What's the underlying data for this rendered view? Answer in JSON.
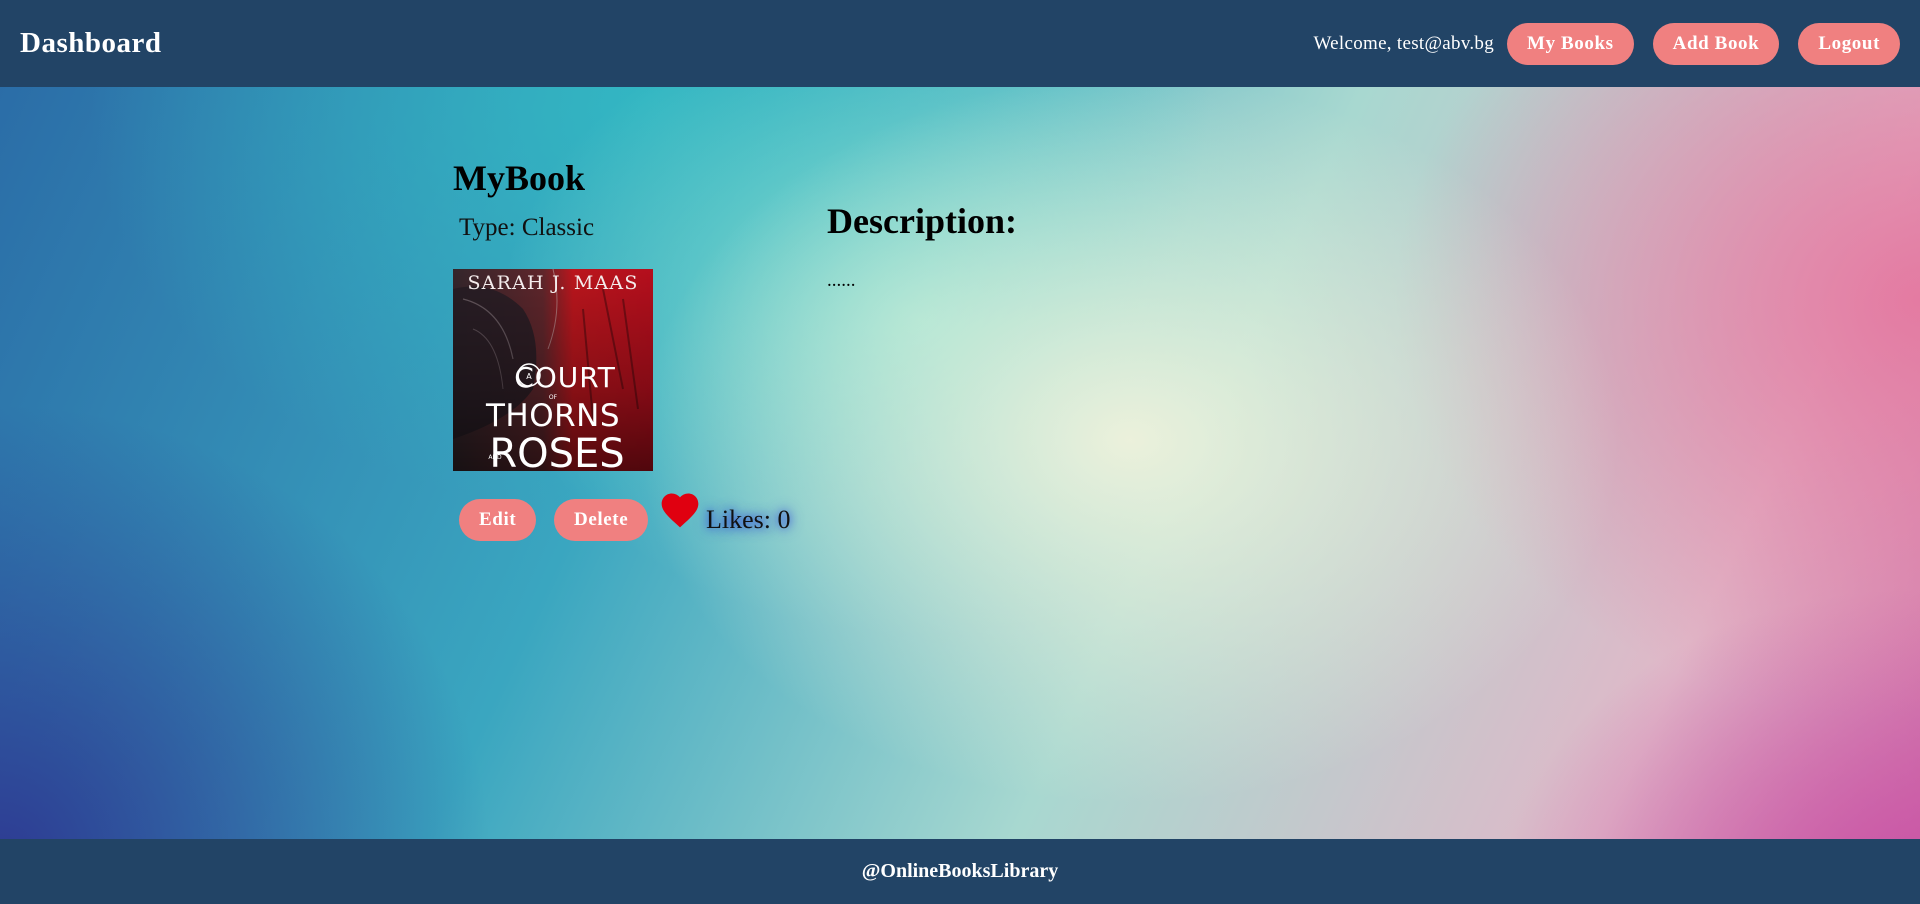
{
  "header": {
    "brand": "Dashboard",
    "welcome": "Welcome, test@abv.bg",
    "nav": {
      "my_books": "My Books",
      "add_book": "Add Book",
      "logout": "Logout"
    }
  },
  "book": {
    "title": "MyBook",
    "type": "Type: Classic",
    "cover": {
      "author": "SARAH J. MAAS",
      "line1": "COURT",
      "line2": "THORNS",
      "line3": "ROSES",
      "small_a": "A",
      "small_of": "OF",
      "small_and": "AND"
    },
    "edit_label": "Edit",
    "delete_label": "Delete",
    "likes": "Likes: 0"
  },
  "description": {
    "heading": "Description:",
    "text": "......"
  },
  "footer": {
    "text": "@OnlineBooksLibrary"
  },
  "colors": {
    "header_bg": "#224466",
    "button_bg": "#f08080",
    "heart": "#e00010"
  },
  "icons": {
    "like": "heart-icon"
  }
}
